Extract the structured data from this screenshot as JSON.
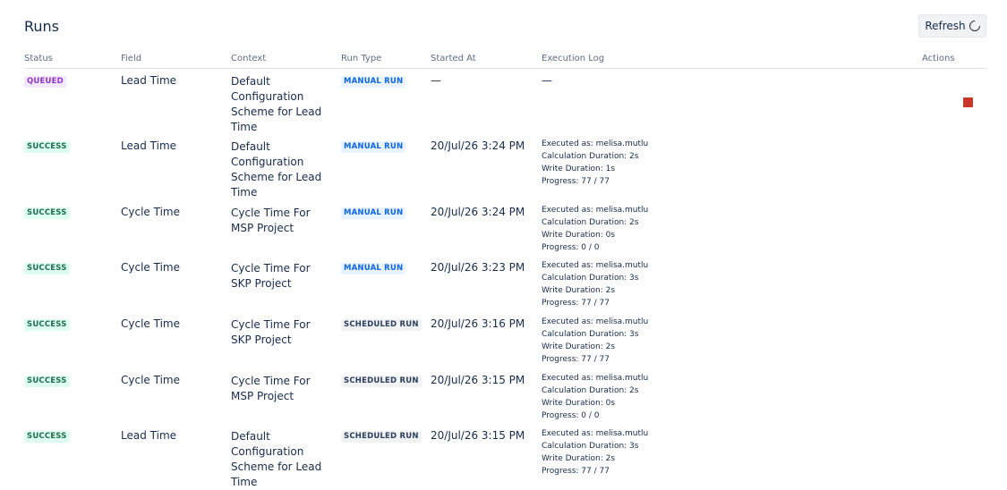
{
  "page": {
    "title": "Runs",
    "refresh_label": "Refresh"
  },
  "columns": {
    "status": "Status",
    "field": "Field",
    "context": "Context",
    "run_type": "Run Type",
    "started_at": "Started At",
    "execution_log": "Execution Log",
    "actions": "Actions"
  },
  "rows": [
    {
      "status": "QUEUED",
      "field": "Lead Time",
      "context": "Default Configuration Scheme for Lead Time",
      "run_type": "MANUAL RUN",
      "started": "—",
      "log_empty": "—"
    },
    {
      "status": "SUCCESS",
      "field": "Lead Time",
      "context": "Default Configuration Scheme for Lead Time",
      "run_type": "MANUAL RUN",
      "started": "20/Jul/26 3:24 PM",
      "log": {
        "executed": "Executed as: melisa.mutlu",
        "calc": "Calculation Duration: 2s",
        "write": "Write Duration: 1s",
        "progress": "Progress: 77 / 77"
      }
    },
    {
      "status": "SUCCESS",
      "field": "Cycle Time",
      "context": "Cycle Time For MSP Project",
      "run_type": "MANUAL RUN",
      "started": "20/Jul/26 3:24 PM",
      "log": {
        "executed": "Executed as: melisa.mutlu",
        "calc": "Calculation Duration: 2s",
        "write": "Write Duration: 0s",
        "progress": "Progress: 0 / 0"
      }
    },
    {
      "status": "SUCCESS",
      "field": "Cycle Time",
      "context": "Cycle Time For SKP Project",
      "run_type": "MANUAL RUN",
      "started": "20/Jul/26 3:23 PM",
      "log": {
        "executed": "Executed as: melisa.mutlu",
        "calc": "Calculation Duration: 3s",
        "write": "Write Duration: 2s",
        "progress": "Progress: 77 / 77"
      }
    },
    {
      "status": "SUCCESS",
      "field": "Cycle Time",
      "context": "Cycle Time For SKP Project",
      "run_type": "SCHEDULED RUN",
      "started": "20/Jul/26 3:16 PM",
      "log": {
        "executed": "Executed as: melisa.mutlu",
        "calc": "Calculation Duration: 3s",
        "write": "Write Duration: 2s",
        "progress": "Progress: 77 / 77"
      }
    },
    {
      "status": "SUCCESS",
      "field": "Cycle Time",
      "context": "Cycle Time For MSP Project",
      "run_type": "SCHEDULED RUN",
      "started": "20/Jul/26 3:15 PM",
      "log": {
        "executed": "Executed as: melisa.mutlu",
        "calc": "Calculation Duration: 2s",
        "write": "Write Duration: 0s",
        "progress": "Progress: 0 / 0"
      }
    },
    {
      "status": "SUCCESS",
      "field": "Lead Time",
      "context": "Default Configuration Scheme for Lead Time",
      "run_type": "SCHEDULED RUN",
      "started": "20/Jul/26 3:15 PM",
      "log": {
        "executed": "Executed as: melisa.mutlu",
        "calc": "Calculation Duration: 3s",
        "write": "Write Duration: 2s",
        "progress": "Progress: 77 / 77"
      }
    }
  ],
  "colors": {
    "queued": "#8f35c9",
    "success": "#216e4e",
    "manual": "#0c66e4",
    "stop": "#c9372c"
  },
  "icons": {
    "refresh": "spinner-icon",
    "stop": "stop-icon"
  }
}
